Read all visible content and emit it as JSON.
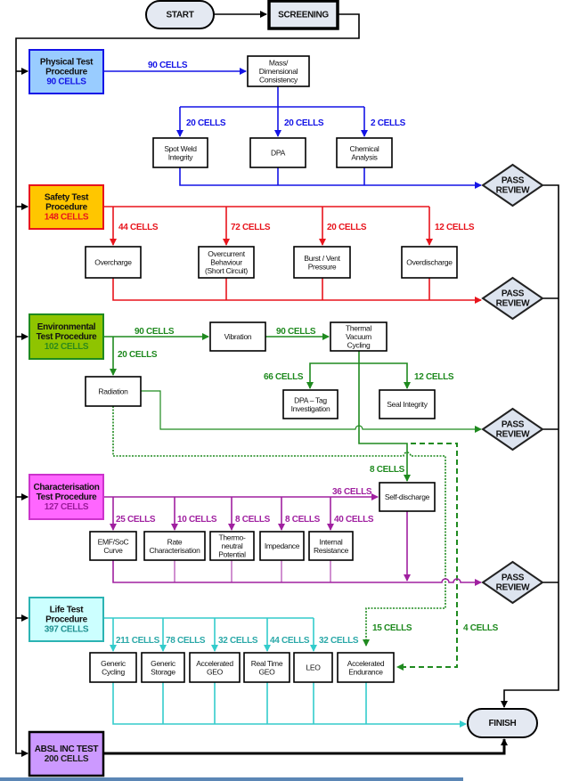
{
  "colors": {
    "physical": "#1414e6",
    "safety": "#e8141c",
    "environmental": "#1f8a1f",
    "characterisation": "#a020a0",
    "life": "#33cccc",
    "flow": "#000000",
    "review_fill": "#dde4ef"
  },
  "nodes": {
    "start": {
      "lines": [
        "START"
      ]
    },
    "screening": {
      "lines": [
        "SCREENING"
      ]
    },
    "physical": {
      "lines": [
        "Physical Test",
        "Procedure"
      ],
      "count": "90 CELLS"
    },
    "mass": {
      "lines": [
        "Mass/",
        "Dimensional",
        "Consistency"
      ]
    },
    "spot_weld": {
      "lines": [
        "Spot Weld",
        "Integrity"
      ]
    },
    "dpa": {
      "lines": [
        "DPA"
      ]
    },
    "chemical": {
      "lines": [
        "Chemical",
        "Analysis"
      ]
    },
    "review_physical": {
      "lines": [
        "PASS",
        "REVIEW"
      ]
    },
    "safety": {
      "lines": [
        "Safety Test",
        "Procedure"
      ],
      "count": "148 CELLS"
    },
    "overcharge": {
      "lines": [
        "Overcharge"
      ]
    },
    "overcurrent": {
      "lines": [
        "Overcurrent",
        "Behaviour",
        "(Short Circuit)"
      ]
    },
    "burst": {
      "lines": [
        "Burst / Vent",
        "Pressure"
      ]
    },
    "overdischarge": {
      "lines": [
        "Overdischarge"
      ]
    },
    "review_safety": {
      "lines": [
        "PASS",
        "REVIEW"
      ]
    },
    "environmental": {
      "lines": [
        "Environmental",
        "Test Procedure"
      ],
      "count": "102 CELLS"
    },
    "vibration": {
      "lines": [
        "Vibration"
      ]
    },
    "thermal": {
      "lines": [
        "Thermal",
        "Vacuum",
        "Cycling"
      ]
    },
    "radiation": {
      "lines": [
        "Radiation"
      ]
    },
    "dpa_tag": {
      "lines": [
        "DPA – Tag",
        "Investigation"
      ]
    },
    "seal": {
      "lines": [
        "Seal Integrity"
      ]
    },
    "review_env": {
      "lines": [
        "PASS",
        "REVIEW"
      ]
    },
    "characterisation": {
      "lines": [
        "Characterisation",
        "Test Procedure"
      ],
      "count": "127 CELLS"
    },
    "self_discharge": {
      "lines": [
        "Self-discharge"
      ]
    },
    "emf": {
      "lines": [
        "EMF/SoC",
        "Curve"
      ]
    },
    "rate": {
      "lines": [
        "Rate",
        "Characterisation"
      ]
    },
    "thermo": {
      "lines": [
        "Thermo-",
        "neutral",
        "Potential"
      ]
    },
    "impedance": {
      "lines": [
        "Impedance"
      ]
    },
    "internal": {
      "lines": [
        "Internal",
        "Resistance"
      ]
    },
    "review_char": {
      "lines": [
        "PASS",
        "REVIEW"
      ]
    },
    "life": {
      "lines": [
        "Life Test",
        "Procedure"
      ],
      "count": "397 CELLS"
    },
    "generic_cycling": {
      "lines": [
        "Generic",
        "Cycling"
      ]
    },
    "generic_storage": {
      "lines": [
        "Generic",
        "Storage"
      ]
    },
    "accel_geo": {
      "lines": [
        "Accelerated",
        "GEO"
      ]
    },
    "realtime_geo": {
      "lines": [
        "Real Time",
        "GEO"
      ]
    },
    "leo": {
      "lines": [
        "LEO"
      ]
    },
    "accel_endurance": {
      "lines": [
        "Accelerated",
        "Endurance"
      ]
    },
    "finish": {
      "lines": [
        "FINISH"
      ]
    },
    "absl": {
      "lines": [
        "ABSL INC TEST"
      ],
      "count": "200 CELLS"
    }
  },
  "edge_labels": {
    "phys_mass": "90 CELLS",
    "phys_spot": "20 CELLS",
    "phys_dpa": "20 CELLS",
    "phys_chem": "2 CELLS",
    "saf_overcharge": "44 CELLS",
    "saf_overcurrent": "72 CELLS",
    "saf_burst": "20 CELLS",
    "saf_overdischarge": "12 CELLS",
    "env_vibration": "90 CELLS",
    "env_thermal": "90 CELLS",
    "env_radiation": "20 CELLS",
    "env_dpa_tag": "66 CELLS",
    "env_seal": "12 CELLS",
    "env_self_discharge": "8 CELLS",
    "env_accel_endurance_15": "15 CELLS",
    "env_accel_endurance_4": "4 CELLS",
    "char_self_discharge": "36 CELLS",
    "char_emf": "25 CELLS",
    "char_rate": "10 CELLS",
    "char_thermo": "8 CELLS",
    "char_impedance": "8 CELLS",
    "char_internal": "40 CELLS",
    "life_cycling": "211 CELLS",
    "life_storage": "78 CELLS",
    "life_accel_geo": "32 CELLS",
    "life_realtime_geo": "44 CELLS",
    "life_leo": "32 CELLS"
  }
}
